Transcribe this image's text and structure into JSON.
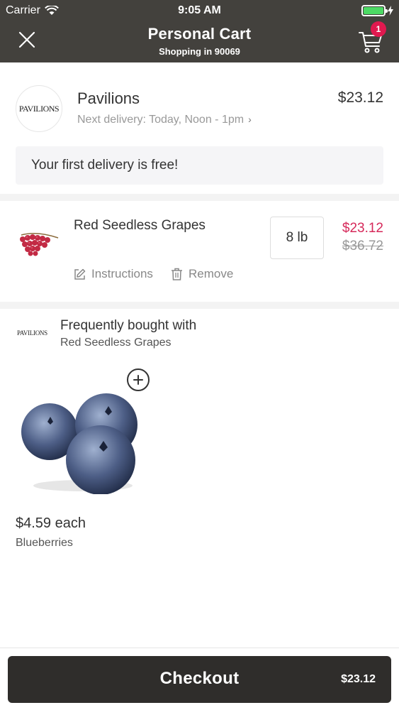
{
  "status_bar": {
    "carrier": "Carrier",
    "time": "9:05 AM"
  },
  "nav": {
    "title": "Personal Cart",
    "subtitle": "Shopping in 90069",
    "cart_count": "1",
    "accent": "#e0194f",
    "bar_color": "#43413d"
  },
  "store": {
    "logo_text": "PAVILIONS",
    "name": "Pavilions",
    "total": "$23.12",
    "delivery": "Next delivery: Today, Noon - 1pm",
    "free_delivery_banner": "Your first delivery is free!"
  },
  "cart_item": {
    "name": "Red Seedless Grapes",
    "quantity": "8 lb",
    "price": "$23.12",
    "original_price": "$36.72",
    "price_color": "#d6295a",
    "instructions_label": "Instructions",
    "remove_label": "Remove"
  },
  "frequently_bought": {
    "logo_text": "PAVILIONS",
    "title": "Frequently bought with",
    "subtitle": "Red Seedless Grapes",
    "products": [
      {
        "price": "$4.59 each",
        "name": "Blueberries"
      }
    ]
  },
  "checkout": {
    "label": "Checkout",
    "total": "$23.12"
  },
  "icons": {
    "close": "close-icon",
    "cart": "cart-icon",
    "chevron": "chevron-right-icon",
    "instructions": "edit-icon",
    "remove": "trash-icon",
    "add": "plus-icon"
  }
}
